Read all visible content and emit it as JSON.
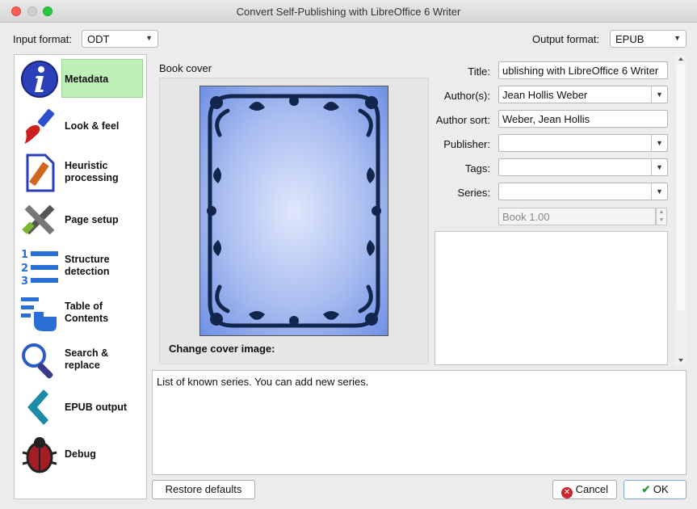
{
  "window": {
    "title": "Convert Self-Publishing with LibreOffice 6 Writer"
  },
  "input_format": {
    "label": "Input format:",
    "value": "ODT"
  },
  "output_format": {
    "label": "Output format:",
    "value": "EPUB"
  },
  "sidebar": {
    "items": [
      {
        "label": "Metadata",
        "icon": "info-icon",
        "active": true
      },
      {
        "label": "Look & feel",
        "icon": "paintbrush-icon"
      },
      {
        "label": "Heuristic processing",
        "icon": "document-pencil-icon"
      },
      {
        "label": "Page setup",
        "icon": "tools-icon"
      },
      {
        "label": "Structure detection",
        "icon": "numbered-list-icon"
      },
      {
        "label": "Table of Contents",
        "icon": "toc-pointer-icon"
      },
      {
        "label": "Search & replace",
        "icon": "magnifier-icon"
      },
      {
        "label": "EPUB output",
        "icon": "chevron-left-icon"
      },
      {
        "label": "Debug",
        "icon": "bug-icon"
      }
    ]
  },
  "cover": {
    "label": "Book cover",
    "change_label": "Change cover image:"
  },
  "metadata": {
    "title_label": "Title:",
    "title_value": "ublishing with LibreOffice 6 Writer",
    "authors_label": "Author(s):",
    "authors_value": "Jean Hollis Weber",
    "author_sort_label": "Author sort:",
    "author_sort_value": "Weber, Jean Hollis",
    "publisher_label": "Publisher:",
    "publisher_value": "",
    "tags_label": "Tags:",
    "tags_value": "",
    "series_label": "Series:",
    "series_value": "",
    "series_index": "Book 1.00"
  },
  "help_text": "List of known series. You can add new series.",
  "buttons": {
    "restore": "Restore defaults",
    "cancel": "Cancel",
    "ok": "OK"
  }
}
